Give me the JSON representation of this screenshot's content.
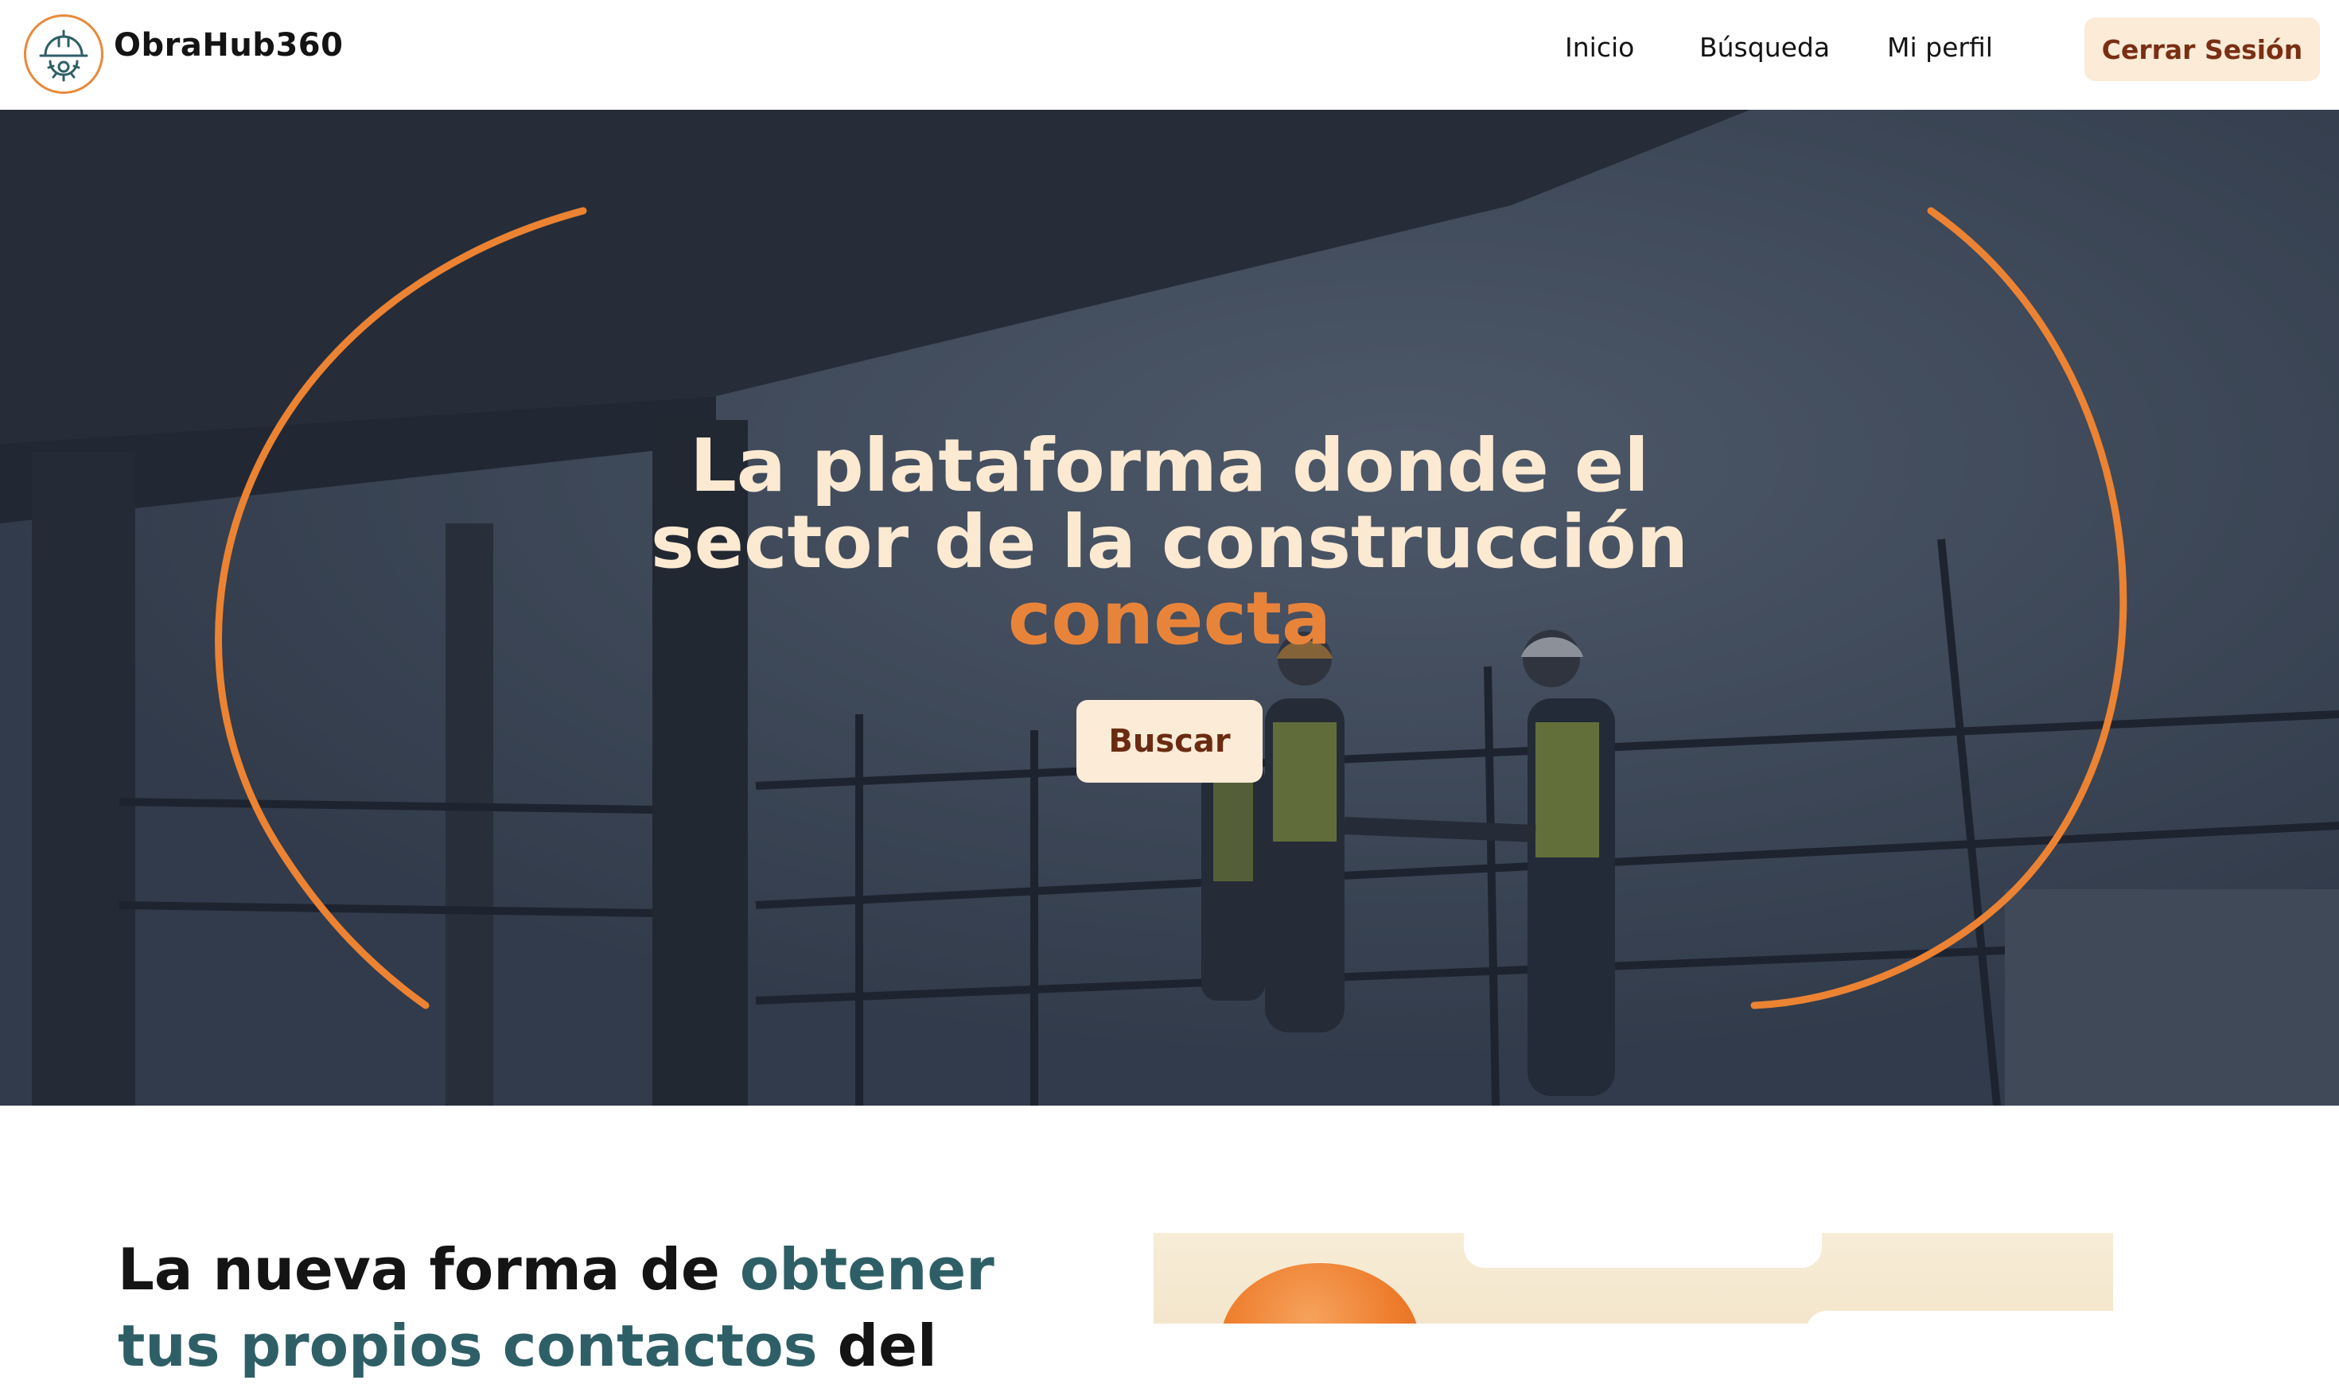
{
  "brand": {
    "name": "ObraHub360"
  },
  "nav": {
    "items": [
      {
        "label": "Inicio"
      },
      {
        "label": "Búsqueda"
      },
      {
        "label": "Mi perfil"
      }
    ],
    "logout_label": "Cerrar Sesión"
  },
  "hero": {
    "title_line1": "La plataforma donde el",
    "title_line2": "sector de la construcción",
    "title_accent": "conecta",
    "button_label": "Buscar"
  },
  "section": {
    "heading_part1": "La nueva forma de ",
    "heading_highlight": "obtener tus propios contactos",
    "heading_part2": " del"
  },
  "colors": {
    "accent_orange": "#e8843a",
    "cream": "#fbebd7",
    "button_text": "#7a2f14",
    "teal": "#2f5f66"
  },
  "icons": {
    "logo": "helmet-gear-icon"
  }
}
